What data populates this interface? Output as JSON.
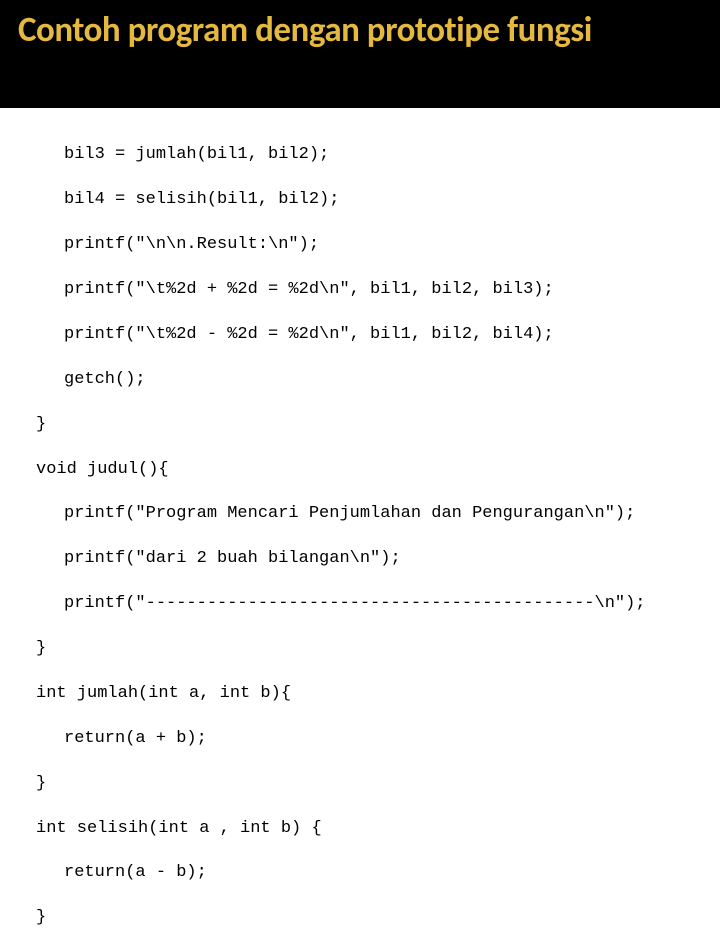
{
  "title": "Contoh program dengan prototipe fungsi",
  "code": {
    "l1": "bil3 = jumlah(bil1, bil2);",
    "l2": "bil4 = selisih(bil1, bil2);",
    "l3": "printf(\"\\n\\n.Result:\\n\");",
    "l4": "printf(\"\\t%2d + %2d = %2d\\n\", bil1, bil2, bil3);",
    "l5": "printf(\"\\t%2d - %2d = %2d\\n\", bil1, bil2, bil4);",
    "l6": "getch();",
    "l7": "}",
    "l8": "void judul(){",
    "l9": "printf(\"Program Mencari Penjumlahan dan Pengurangan\\n\");",
    "l10": "printf(\"dari 2 buah bilangan\\n\");",
    "l11": "printf(\"--------------------------------------------\\n\");",
    "l12": "}",
    "l13": "int jumlah(int a, int b){",
    "l14": "return(a + b);",
    "l15": "}",
    "l16": "int selisih(int a , int b) {",
    "l17": "return(a - b);",
    "l18": "}"
  }
}
